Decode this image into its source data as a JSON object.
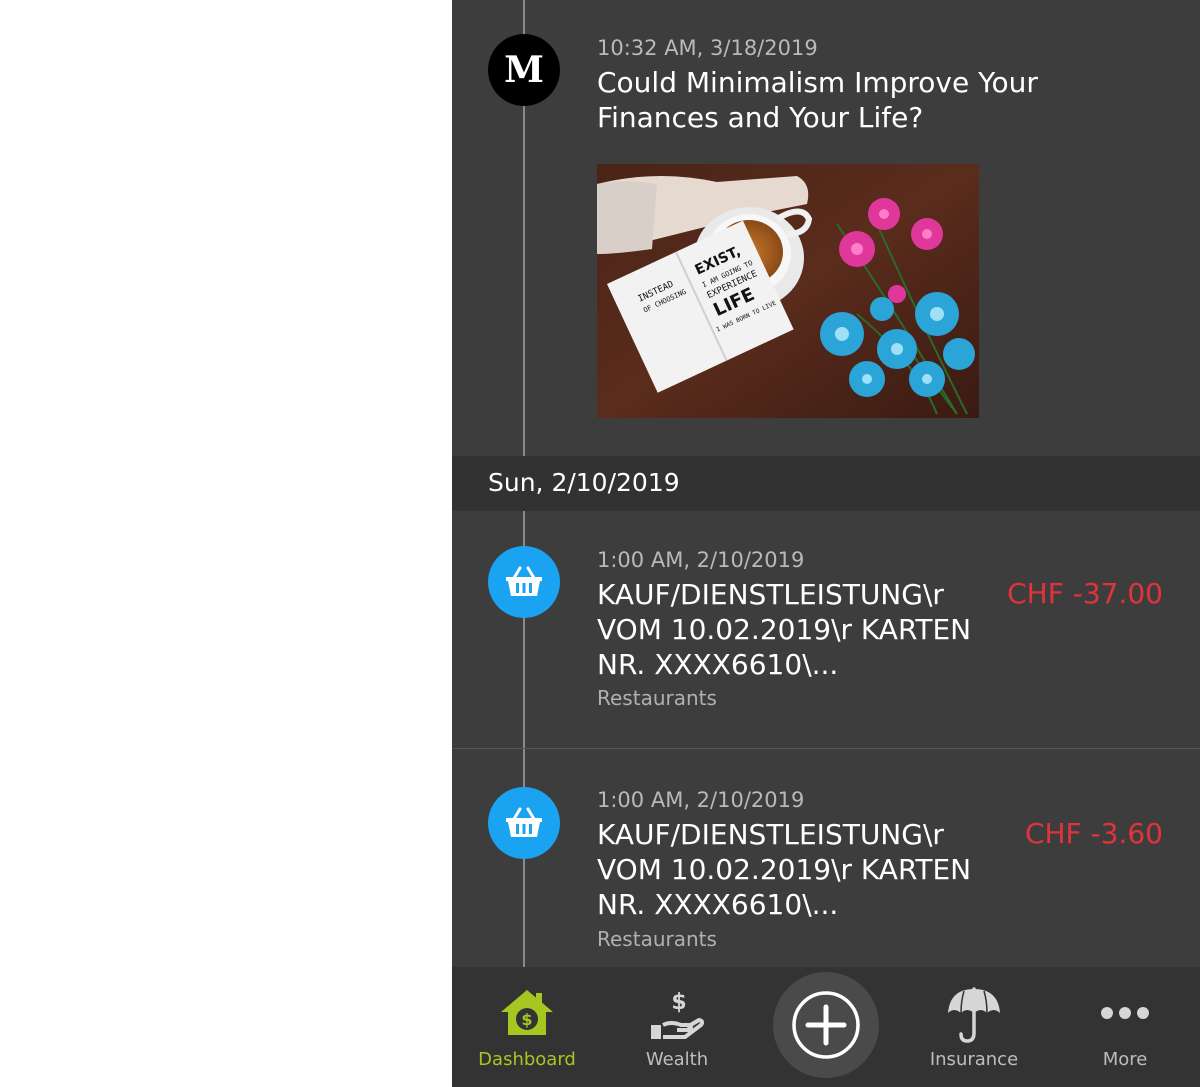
{
  "feed": {
    "article": {
      "timestamp": "10:32 AM, 3/18/2019",
      "title": "Could Minimalism Improve Your Finances and Your Life?",
      "source_icon": "M",
      "image_caption_lines": [
        "INSTEAD",
        "OF CHOOSING",
        "EXIST,",
        "I AM GOING TO",
        "EXPERIENCE",
        "LIFE",
        "I WAS BORN TO LIVE"
      ]
    },
    "date_header": "Sun, 2/10/2019",
    "transactions": [
      {
        "timestamp": "1:00 AM, 2/10/2019",
        "description": "KAUF/DIENSTLEISTUNG\\r VOM 10.02.2019\\r KARTEN NR. XXXX6610\\...",
        "amount": "CHF -37.00",
        "category": "Restaurants",
        "icon": "basket-icon"
      },
      {
        "timestamp": "1:00 AM, 2/10/2019",
        "description": "KAUF/DIENSTLEISTUNG\\r VOM 10.02.2019\\r KARTEN NR. XXXX6610\\...",
        "amount": "CHF -3.60",
        "category": "Restaurants",
        "icon": "basket-icon"
      }
    ]
  },
  "navbar": {
    "items": [
      {
        "label": "Dashboard",
        "icon": "house-dollar-icon",
        "active": true
      },
      {
        "label": "Wealth",
        "icon": "hand-dollar-icon",
        "active": false
      },
      {
        "label": "Add",
        "icon": "plus-circle-icon",
        "active": false
      },
      {
        "label": "Insurance",
        "icon": "umbrella-icon",
        "active": false
      },
      {
        "label": "More",
        "icon": "more-dots-icon",
        "active": false
      }
    ]
  },
  "colors": {
    "background": "#3d3d3d",
    "accent": "#a6c622",
    "negative_amount": "#e2333b",
    "transaction_icon": "#1aa3f0"
  }
}
